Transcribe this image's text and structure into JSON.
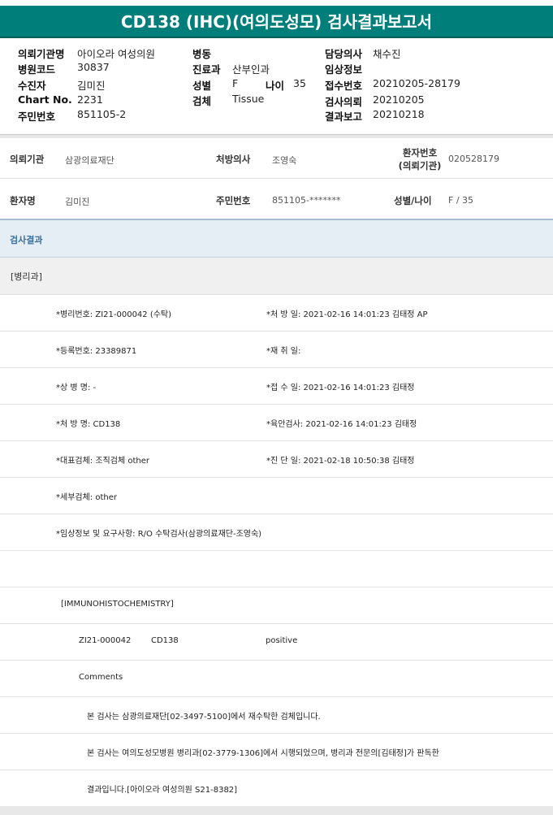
{
  "title": "CD138 (IHC)(여의도성모) 검사결과보고서",
  "header": {
    "col1": [
      {
        "label": "의뢰기관명",
        "value": "아이오라 여성의원"
      },
      {
        "label": "병원코드",
        "value": "30837"
      },
      {
        "label": "수진자",
        "value": "김미진"
      },
      {
        "label": "Chart No.",
        "value": "2231"
      },
      {
        "label": "주민번호",
        "value": "851105-2"
      }
    ],
    "col2": [
      {
        "label": "병동",
        "value": ""
      },
      {
        "label": "진료과",
        "value": "산부인과"
      },
      {
        "label": "성별",
        "value": "F"
      },
      {
        "label": "검체",
        "value": "Tissue"
      }
    ],
    "age_label": "나이",
    "age_value": "35",
    "col3": [
      {
        "label": "담당의사",
        "value": "채수진"
      },
      {
        "label": "임상정보",
        "value": ""
      },
      {
        "label": "접수번호",
        "value": "20210205-28179"
      },
      {
        "label": "검사의뢰",
        "value": "20210205"
      },
      {
        "label": "결과보고",
        "value": "20210218"
      }
    ]
  },
  "patient": {
    "institution_label": "의뢰기관",
    "institution_value": "삼광의료재단",
    "doctor_label": "처방의사",
    "doctor_value": "조영숙",
    "patient_no_label_1": "환자번호",
    "patient_no_label_2": "(의뢰기관)",
    "patient_no_value": "020528179",
    "name_label": "환자명",
    "name_value": "김미진",
    "rrn_label": "주민번호",
    "rrn_value": "851105-*******",
    "sexage_label": "성별/나이",
    "sexage_value": "F / 35"
  },
  "result": {
    "section_label": "검사결과",
    "dept": "[병리과]",
    "lines": [
      {
        "left": "*병리번호: ZI21-000042 (수탁)",
        "right": "*처 방 일: 2021-02-16 14:01:23  김태정 AP"
      },
      {
        "left": "*등록번호: 23389871",
        "right": "*재 취 일:"
      },
      {
        "left": "*상 병 명: -",
        "right": "*접 수 일: 2021-02-16 14:01:23  김태정"
      },
      {
        "left": "*처 방 명: CD138",
        "right": "*육안검사: 2021-02-16 14:01:23  김태정"
      },
      {
        "left": "*대표검체: 조직검체 other",
        "right": "*진 단 일: 2021-02-18 10:50:38  김태정"
      },
      {
        "left": "*세부검체: other",
        "right": ""
      },
      {
        "left": "*임상정보 및 요구사항: R/O 수탁검사(삼광의료재단-조영숙)",
        "right": ""
      }
    ],
    "ihc_header": "[IMMUNOHISTOCHEMISTRY]",
    "ihc_row": {
      "no": "ZI21-000042",
      "marker": "CD138",
      "result": "positive"
    },
    "comments_label": "Comments",
    "comment_1": "본 검사는 삼광의료재단[02-3497-5100]에서 재수탁한 검체입니다.",
    "comment_2": "본 검사는 여의도성모병원 병리과[02-3779-1306]에서 시행되었으며, 병리과 전문의[김태정]가 판독한",
    "comment_3": "결과입니다.[아이오라 여성의원 S21-8382]"
  }
}
